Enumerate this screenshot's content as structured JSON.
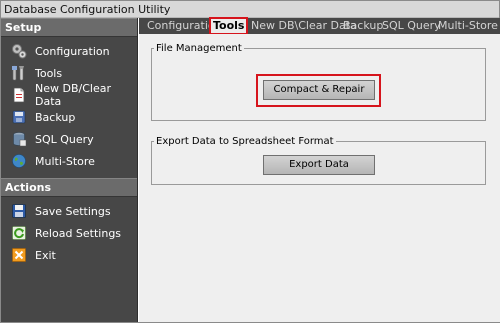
{
  "window": {
    "title": "Database Configuration Utility"
  },
  "sidebar": {
    "setup_label": "Setup",
    "setup_items": [
      {
        "label": "Configuration",
        "icon": "gears-icon"
      },
      {
        "label": "Tools",
        "icon": "tools-icon"
      },
      {
        "label": "New DB/Clear Data",
        "icon": "document-icon"
      },
      {
        "label": "Backup",
        "icon": "backup-icon"
      },
      {
        "label": "SQL Query",
        "icon": "database-icon"
      },
      {
        "label": "Multi-Store",
        "icon": "globe-icon"
      }
    ],
    "actions_label": "Actions",
    "action_items": [
      {
        "label": "Save Settings",
        "icon": "save-icon"
      },
      {
        "label": "Reload Settings",
        "icon": "reload-icon"
      },
      {
        "label": "Exit",
        "icon": "exit-icon"
      }
    ]
  },
  "tabs": [
    {
      "label": "Configuration",
      "active": false
    },
    {
      "label": "Tools",
      "active": true
    },
    {
      "label": "New DB\\Clear Data",
      "active": false
    },
    {
      "label": "Backup",
      "active": false
    },
    {
      "label": "SQL Query",
      "active": false
    },
    {
      "label": "Multi-Store",
      "active": false
    }
  ],
  "file_management": {
    "legend": "File Management",
    "compact_button": "Compact & Repair"
  },
  "export": {
    "legend": "Export Data to Spreadsheet Format",
    "export_button": "Export Data"
  },
  "colors": {
    "sidebar_bg": "#474747",
    "section_bg": "#6b6b6b",
    "highlight": "#d6141c",
    "content_bg": "#efefef"
  }
}
